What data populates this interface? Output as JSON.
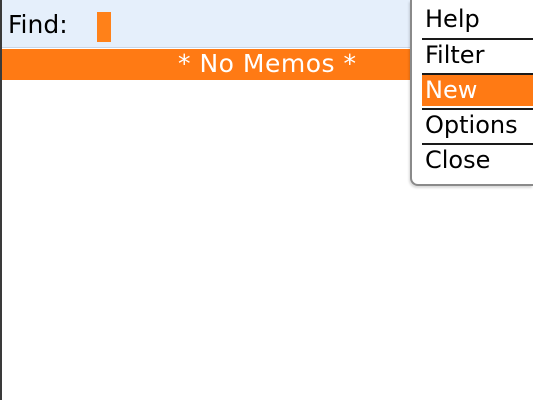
{
  "find": {
    "label": "Find:",
    "value": ""
  },
  "list": {
    "empty_text": "* No Memos *"
  },
  "menu": {
    "items": [
      {
        "label": "Help"
      },
      {
        "label": "Filter"
      },
      {
        "label": "New",
        "selected": true
      },
      {
        "label": "Options"
      },
      {
        "label": "Close"
      }
    ]
  },
  "colors": {
    "accent": "#ff7a14",
    "find_bar_bg": "#e5effb",
    "background": "#ffffff"
  }
}
